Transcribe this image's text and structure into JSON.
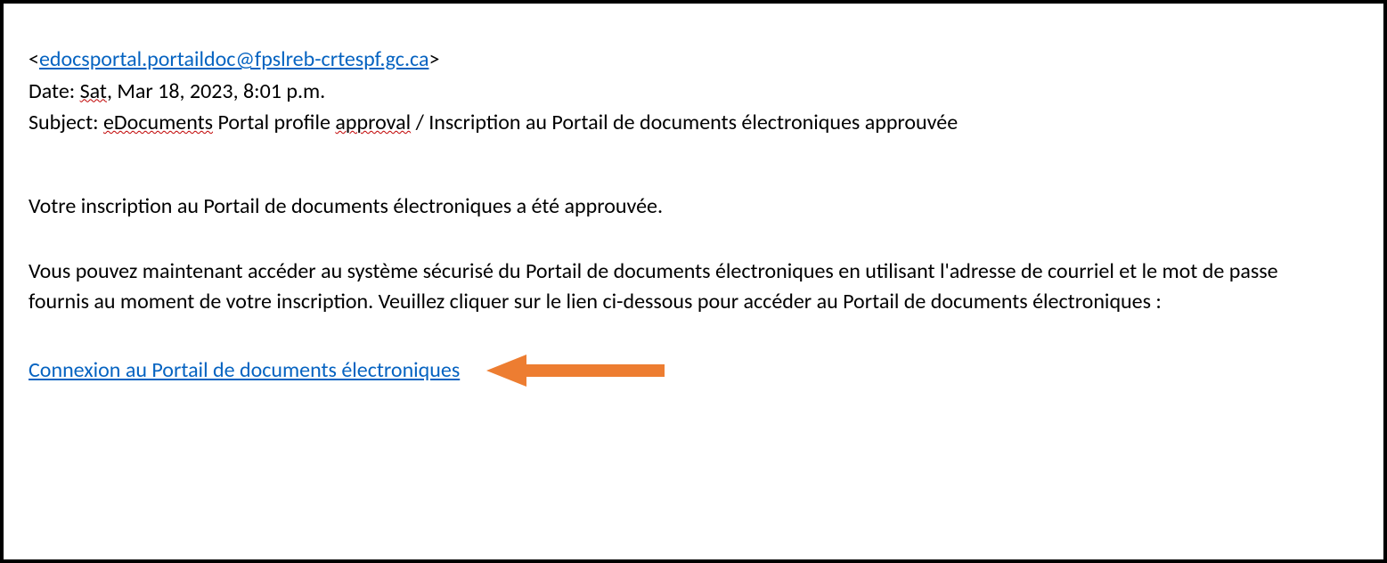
{
  "email": {
    "sender_prefix": "<",
    "sender_address": "edocsportal.portaildoc@fpslreb-crtespf.gc.ca",
    "sender_suffix": ">",
    "date_label": "Date: ",
    "date_sat": "Sat",
    "date_rest": ", Mar 18, 2023, 8:01 p.m.",
    "subject_label": "Subject: ",
    "subject_word1": "eDocuments",
    "subject_mid": " Portal profile ",
    "subject_word2": "approval",
    "subject_rest": " / Inscription au Portail de documents électroniques approuvée",
    "paragraph1": "Votre inscription au Portail de documents électroniques a été approuvée.",
    "paragraph2": "Vous pouvez maintenant accéder au système sécurisé du Portail de documents électroniques en utilisant l'adresse de courriel et le mot de passe fournis au moment de votre inscription. Veuillez cliquer sur le lien ci-dessous pour accéder au Portail de documents électroniques :",
    "login_link_text": "Connexion au Portail de documents électroniques"
  },
  "colors": {
    "link": "#0563c1",
    "arrow": "#ed7d31"
  }
}
